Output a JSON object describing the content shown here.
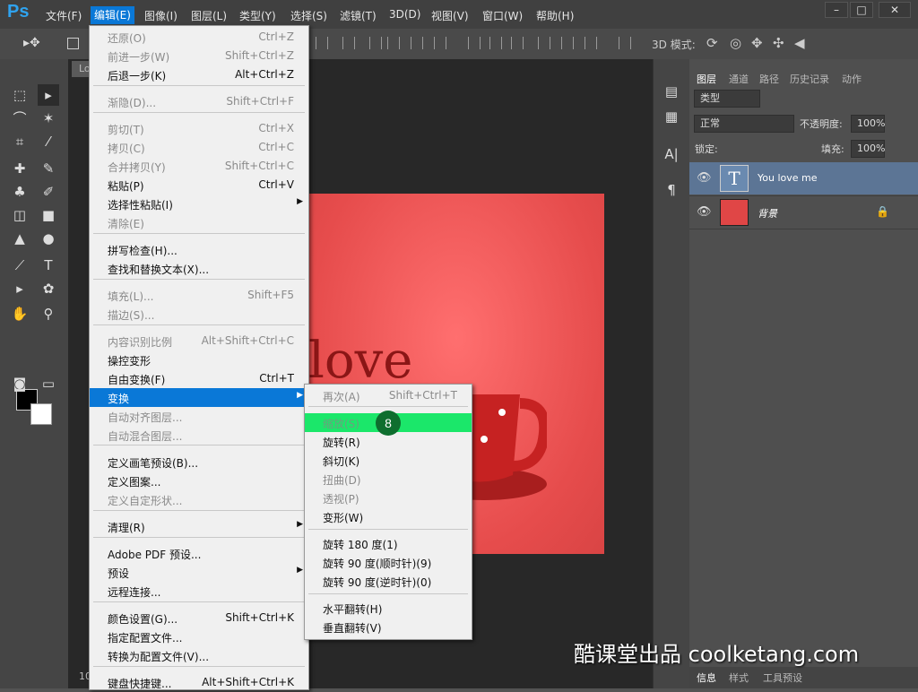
{
  "app": {
    "logo": "Ps"
  },
  "menubar": {
    "items": [
      "文件(F)",
      "编辑(E)",
      "图像(I)",
      "图层(L)",
      "类型(Y)",
      "选择(S)",
      "滤镜(T)",
      "3D(D)",
      "视图(V)",
      "窗口(W)",
      "帮助(H)"
    ]
  },
  "window": {
    "minimize": "–",
    "maximize": "□",
    "close": "✕"
  },
  "options_bar": {
    "label_3d": "3D 模式:"
  },
  "document": {
    "tab_label": "Lo",
    "zoom": "10",
    "canvas_text": "love"
  },
  "layers_panel": {
    "tabs": [
      "图层",
      "通道",
      "路径",
      "历史记录",
      "动作"
    ],
    "filter_kind": "类型",
    "blend_mode": "正常",
    "opacity_label": "不透明度:",
    "opacity_value": "100%",
    "lock_label": "锁定:",
    "fill_label": "填充:",
    "fill_value": "100%",
    "layers": [
      {
        "name": "You love me",
        "thumb": "T"
      },
      {
        "name": "背景"
      }
    ]
  },
  "bottom_tabs": [
    "信息",
    "样式",
    "工具预设"
  ],
  "edit_menu": {
    "items": [
      {
        "label": "还原(O)",
        "shortcut": "Ctrl+Z",
        "disabled": true
      },
      {
        "label": "前进一步(W)",
        "shortcut": "Shift+Ctrl+Z",
        "disabled": true
      },
      {
        "label": "后退一步(K)",
        "shortcut": "Alt+Ctrl+Z",
        "disabled": false
      },
      {
        "label": "渐隐(D)...",
        "shortcut": "Shift+Ctrl+F",
        "disabled": true
      },
      {
        "label": "剪切(T)",
        "shortcut": "Ctrl+X",
        "disabled": true
      },
      {
        "label": "拷贝(C)",
        "shortcut": "Ctrl+C",
        "disabled": true
      },
      {
        "label": "合并拷贝(Y)",
        "shortcut": "Shift+Ctrl+C",
        "disabled": true
      },
      {
        "label": "粘贴(P)",
        "shortcut": "Ctrl+V",
        "disabled": false
      },
      {
        "label": "选择性粘贴(I)",
        "shortcut": "",
        "disabled": false,
        "submenu": true
      },
      {
        "label": "清除(E)",
        "shortcut": "",
        "disabled": true
      },
      {
        "label": "拼写检查(H)...",
        "shortcut": "",
        "disabled": false
      },
      {
        "label": "查找和替换文本(X)...",
        "shortcut": "",
        "disabled": false
      },
      {
        "label": "填充(L)...",
        "shortcut": "Shift+F5",
        "disabled": true
      },
      {
        "label": "描边(S)...",
        "shortcut": "",
        "disabled": true
      },
      {
        "label": "内容识别比例",
        "shortcut": "Alt+Shift+Ctrl+C",
        "disabled": true
      },
      {
        "label": "操控变形",
        "shortcut": "",
        "disabled": false
      },
      {
        "label": "自由变换(F)",
        "shortcut": "Ctrl+T",
        "disabled": false
      },
      {
        "label": "变换",
        "shortcut": "",
        "disabled": false,
        "submenu": true,
        "highlight": true
      },
      {
        "label": "自动对齐图层...",
        "shortcut": "",
        "disabled": true
      },
      {
        "label": "自动混合图层...",
        "shortcut": "",
        "disabled": true
      },
      {
        "label": "定义画笔预设(B)...",
        "shortcut": "",
        "disabled": false
      },
      {
        "label": "定义图案...",
        "shortcut": "",
        "disabled": false
      },
      {
        "label": "定义自定形状...",
        "shortcut": "",
        "disabled": true
      },
      {
        "label": "清理(R)",
        "shortcut": "",
        "disabled": false,
        "submenu": true
      },
      {
        "label": "Adobe PDF 预设...",
        "shortcut": "",
        "disabled": false
      },
      {
        "label": "预设",
        "shortcut": "",
        "disabled": false,
        "submenu": true
      },
      {
        "label": "远程连接...",
        "shortcut": "",
        "disabled": false
      },
      {
        "label": "颜色设置(G)...",
        "shortcut": "Shift+Ctrl+K",
        "disabled": false
      },
      {
        "label": "指定配置文件...",
        "shortcut": "",
        "disabled": false
      },
      {
        "label": "转换为配置文件(V)...",
        "shortcut": "",
        "disabled": false
      },
      {
        "label": "键盘快捷键...",
        "shortcut": "Alt+Shift+Ctrl+K",
        "disabled": false
      }
    ]
  },
  "transform_submenu": {
    "items": [
      {
        "label": "再次(A)",
        "shortcut": "Shift+Ctrl+T",
        "disabled": true
      },
      {
        "label": "缩放(S)",
        "shortcut": "",
        "disabled": false,
        "active": true
      },
      {
        "label": "旋转(R)",
        "shortcut": "",
        "disabled": false
      },
      {
        "label": "斜切(K)",
        "shortcut": "",
        "disabled": false
      },
      {
        "label": "扭曲(D)",
        "shortcut": "",
        "disabled": true
      },
      {
        "label": "透视(P)",
        "shortcut": "",
        "disabled": true
      },
      {
        "label": "变形(W)",
        "shortcut": "",
        "disabled": false
      },
      {
        "label": "旋转 180 度(1)",
        "shortcut": "",
        "disabled": false
      },
      {
        "label": "旋转 90 度(顺时针)(9)",
        "shortcut": "",
        "disabled": false
      },
      {
        "label": "旋转 90 度(逆时针)(0)",
        "shortcut": "",
        "disabled": false
      },
      {
        "label": "水平翻转(H)",
        "shortcut": "",
        "disabled": false
      },
      {
        "label": "垂直翻转(V)",
        "shortcut": "",
        "disabled": false
      }
    ]
  },
  "step_badge": "8",
  "watermark": "酷课堂出品 coolketang.com"
}
